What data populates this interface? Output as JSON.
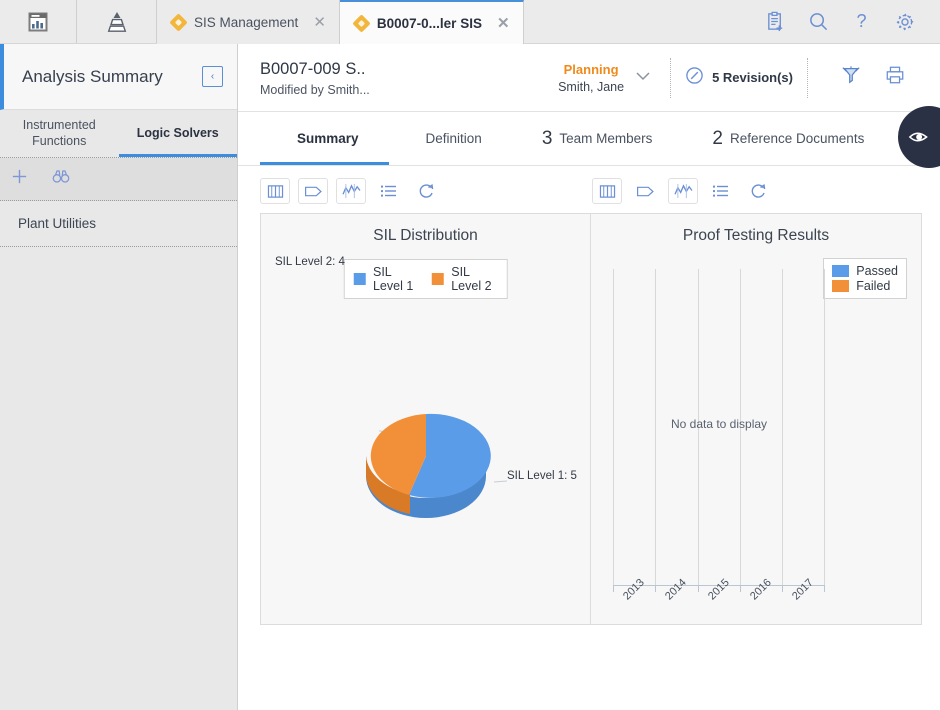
{
  "topbar": {
    "app_icons": [
      {
        "name": "dashboard-icon",
        "label": "Dashboard"
      },
      {
        "name": "hierarchy-pyramid-icon",
        "label": "Hierarchy"
      }
    ],
    "tabs": [
      {
        "label": "SIS Management",
        "active": false,
        "close": "✕"
      },
      {
        "label": "B0007-0...ler SIS",
        "active": true,
        "close": "✕"
      }
    ],
    "right_icons": [
      {
        "name": "clipboard-add-icon",
        "label": "New"
      },
      {
        "name": "search-icon",
        "label": "Search"
      },
      {
        "name": "help-icon",
        "label": "Help"
      },
      {
        "name": "gear-icon",
        "label": "Settings"
      }
    ]
  },
  "sidebar": {
    "title": "Analysis Summary",
    "collapse_label": "‹",
    "tabs": [
      {
        "label": "Instrumented Functions",
        "active": false
      },
      {
        "label": "Logic Solvers",
        "active": true
      }
    ],
    "toolbar": [
      {
        "name": "add-icon",
        "label": "Add"
      },
      {
        "name": "binoculars-icon",
        "label": "Search"
      }
    ],
    "items": [
      {
        "label": "Plant Utilities"
      }
    ]
  },
  "record_header": {
    "id": "B0007-009 S..",
    "modified_by": "Modified by Smith...",
    "state_name": "Planning",
    "state_owner": "Smith, Jane",
    "state_caret": "∨",
    "revisions_label": "5 Revision(s)",
    "icons": [
      {
        "name": "revision-pencil-icon",
        "label": "Revisions"
      },
      {
        "name": "hazard-risk-icon",
        "label": "Risk"
      },
      {
        "name": "print-icon",
        "label": "Print"
      }
    ],
    "fab": {
      "name": "eye-view-icon",
      "label": "View"
    }
  },
  "main_tabs": [
    {
      "count": "",
      "label": "Summary",
      "active": true
    },
    {
      "count": "",
      "label": "Definition",
      "active": false
    },
    {
      "count": "3",
      "label": "Team Members",
      "active": false
    },
    {
      "count": "2",
      "label": "Reference Documents",
      "active": false
    }
  ],
  "chart_toolbars": {
    "left": [
      {
        "name": "book-icon",
        "framed": true
      },
      {
        "name": "tag-icon",
        "framed": true
      },
      {
        "name": "line-chart-icon",
        "framed": true
      },
      {
        "name": "list-icon",
        "framed": false
      },
      {
        "name": "refresh-icon",
        "framed": false
      }
    ],
    "right": [
      {
        "name": "book-icon",
        "framed": true
      },
      {
        "name": "tag-icon",
        "framed": false
      },
      {
        "name": "line-chart-icon",
        "framed": true
      },
      {
        "name": "list-icon",
        "framed": false
      },
      {
        "name": "refresh-icon",
        "framed": false
      }
    ]
  },
  "colors": {
    "series_blue": "#5b9ce8",
    "series_blue_dark": "#4a87cc",
    "series_orange": "#f2903a",
    "series_orange_dark": "#d97a26",
    "accent": "#3c8dde",
    "state_orange": "#f08a1d"
  },
  "chart_data": [
    {
      "type": "pie",
      "title": "SIL Distribution",
      "categories": [
        "SIL Level 1",
        "SIL Level 2"
      ],
      "values": [
        5,
        4
      ],
      "colors": [
        "#5b9ce8",
        "#f2903a"
      ],
      "legend": [
        "SIL Level 1",
        "SIL Level 2"
      ],
      "legend_position": "top",
      "data_labels": [
        "SIL Level 1: 5",
        "SIL Level 2: 4"
      ],
      "three_d": true
    },
    {
      "type": "bar",
      "title": "Proof Testing Results",
      "categories": [
        "2013",
        "2014",
        "2015",
        "2016",
        "2017"
      ],
      "series": [
        {
          "name": "Passed",
          "values": [],
          "color": "#5b9ce8"
        },
        {
          "name": "Failed",
          "values": [],
          "color": "#f2903a"
        }
      ],
      "legend": [
        "Passed",
        "Failed"
      ],
      "legend_position": "top-right",
      "empty_message": "No data to display",
      "grid": true,
      "xlabel": "",
      "ylabel": ""
    }
  ]
}
